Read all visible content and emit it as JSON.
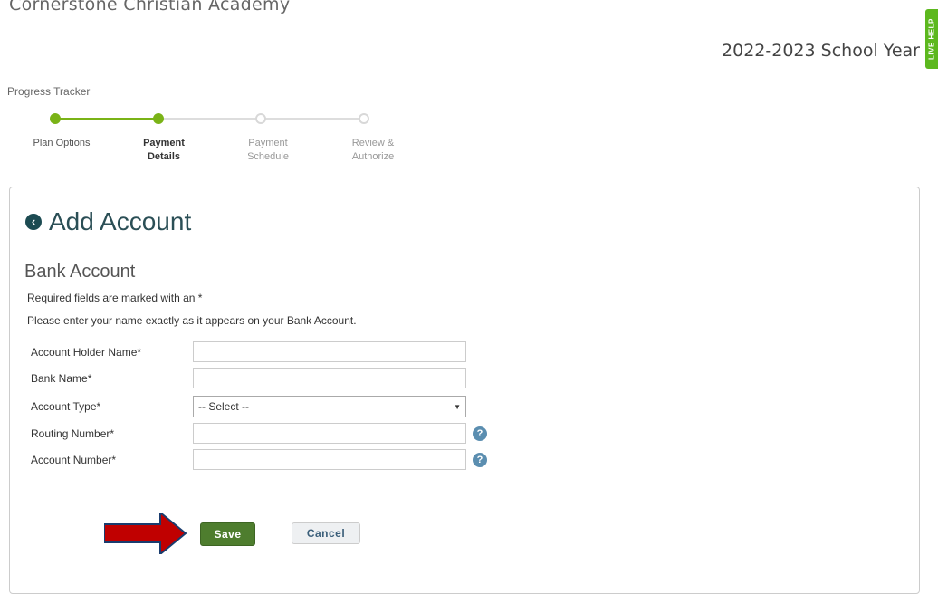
{
  "header": {
    "school_name": "Cornerstone Christian Academy",
    "school_year": "2022-2023 School Year",
    "live_help": "LIVE HELP"
  },
  "tracker": {
    "title": "Progress Tracker",
    "steps": [
      {
        "line1": "Plan Options",
        "line2": "",
        "status": "done"
      },
      {
        "line1": "Payment",
        "line2": "Details",
        "status": "current"
      },
      {
        "line1": "Payment",
        "line2": "Schedule",
        "status": "todo"
      },
      {
        "line1": "Review &",
        "line2": "Authorize",
        "status": "todo"
      }
    ],
    "accent_color": "#7ab317"
  },
  "form": {
    "title": "Add Account",
    "back_icon": "chevron-left-circle-icon",
    "section_title": "Bank Account",
    "required_note": "Required fields are marked with an *",
    "name_note": "Please enter your name exactly as it appears on your Bank Account.",
    "fields": {
      "account_holder": {
        "label": "Account Holder Name*",
        "value": "",
        "placeholder": ""
      },
      "bank_name": {
        "label": "Bank Name*",
        "value": "",
        "placeholder": ""
      },
      "account_type": {
        "label": "Account Type*",
        "selected": "-- Select --"
      },
      "routing_number": {
        "label": "Routing Number*",
        "value": "",
        "placeholder": "",
        "help_icon": "?"
      },
      "account_number": {
        "label": "Account Number*",
        "value": "",
        "placeholder": "",
        "help_icon": "?"
      }
    },
    "buttons": {
      "save": "Save",
      "cancel": "Cancel"
    },
    "colors": {
      "save_bg": "#4e7d2e",
      "annotation_arrow": "#c00000"
    }
  }
}
